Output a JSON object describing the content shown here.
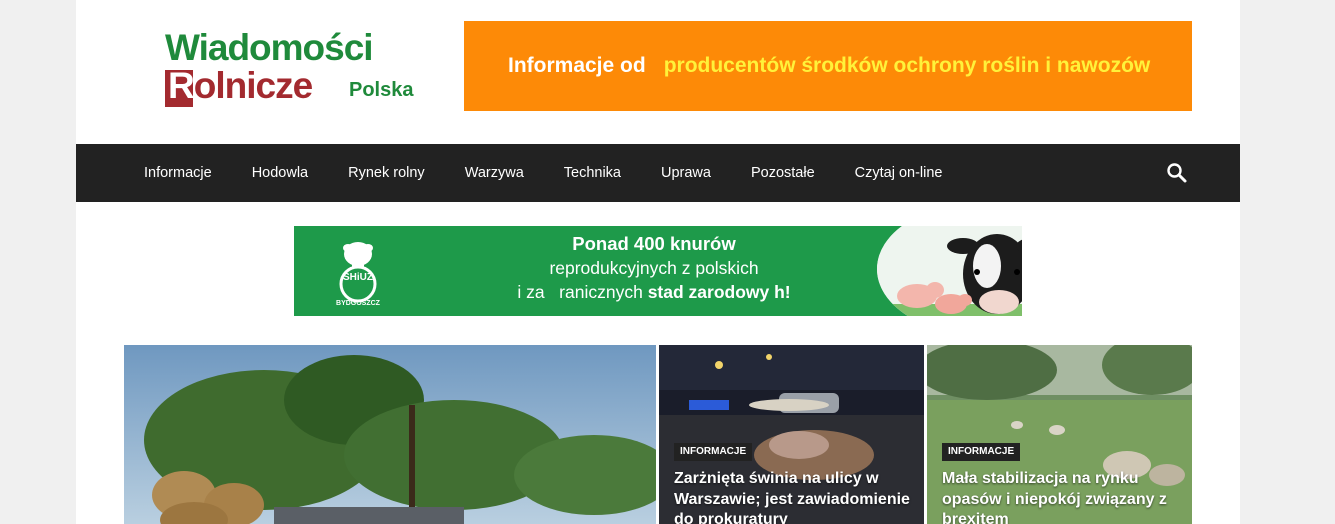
{
  "logo": {
    "line1": "Wiadomości",
    "line2_first": "R",
    "line2_rest": "olnicze",
    "sub": "Polska"
  },
  "top_banner": {
    "part1": "Informacje od",
    "part2": "producentów środków ochrony roślin i nawozów",
    "bg_color": "#fd8a07"
  },
  "nav": {
    "items": [
      "Informacje",
      "Hodowla",
      "Rynek rolny",
      "Warzywa",
      "Technika",
      "Uprawa",
      "Pozostałe",
      "Czytaj on-line"
    ],
    "search_icon": "search-icon",
    "bg_color": "#222222"
  },
  "mid_banner": {
    "brand": "SHiUZ",
    "city": "BYDGOSZCZ",
    "line1": "Ponad 400 knurów",
    "line2": "reprodukcyjnych z polskich",
    "line3_start": "i za   ranicznych ",
    "line3_bold": "stad zarodowy  h!",
    "bg_color": "#1e9a4a"
  },
  "articles": [
    {
      "badge": "INFORMACJE",
      "title": "Zarżnięta świnia na ulicy w Warszawie; jest zawiadomienie do prokuratury"
    },
    {
      "badge": "INFORMACJE",
      "title": "Mała stabilizacja na rynku opasów i niepokój związany z brexitem"
    }
  ]
}
